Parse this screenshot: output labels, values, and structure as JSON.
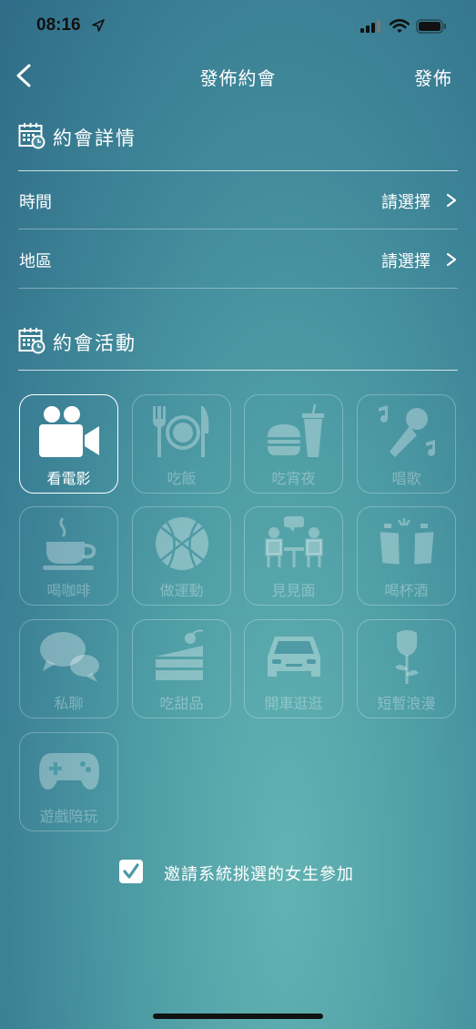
{
  "status_bar": {
    "time": "08:16"
  },
  "header": {
    "title": "發佈約會",
    "publish_label": "發佈"
  },
  "details_section": {
    "title": "約會詳情",
    "rows": [
      {
        "label": "時間",
        "value": "請選擇"
      },
      {
        "label": "地區",
        "value": "請選擇"
      }
    ]
  },
  "activity_section": {
    "title": "約會活動",
    "activities": [
      {
        "label": "看電影",
        "icon": "movie-camera-icon",
        "selected": true
      },
      {
        "label": "吃飯",
        "icon": "plate-cutlery-icon",
        "selected": false
      },
      {
        "label": "吃宵夜",
        "icon": "burger-drink-icon",
        "selected": false
      },
      {
        "label": "唱歌",
        "icon": "microphone-icon",
        "selected": false
      },
      {
        "label": "喝咖啡",
        "icon": "coffee-cup-icon",
        "selected": false
      },
      {
        "label": "做運動",
        "icon": "basketball-icon",
        "selected": false
      },
      {
        "label": "見見面",
        "icon": "meeting-icon",
        "selected": false
      },
      {
        "label": "喝杯酒",
        "icon": "beer-mugs-icon",
        "selected": false
      },
      {
        "label": "私聊",
        "icon": "chat-bubbles-icon",
        "selected": false
      },
      {
        "label": "吃甜品",
        "icon": "cake-icon",
        "selected": false
      },
      {
        "label": "開車逛逛",
        "icon": "car-icon",
        "selected": false
      },
      {
        "label": "短暫浪漫",
        "icon": "rose-icon",
        "selected": false
      },
      {
        "label": "遊戲陪玩",
        "icon": "gamepad-icon",
        "selected": false
      }
    ]
  },
  "invite_option": {
    "label": "邀請系統挑選的女生參加",
    "checked": true
  },
  "colors": {
    "background": "#4f9ea6",
    "checkbox_check": "#4a9aa6"
  }
}
